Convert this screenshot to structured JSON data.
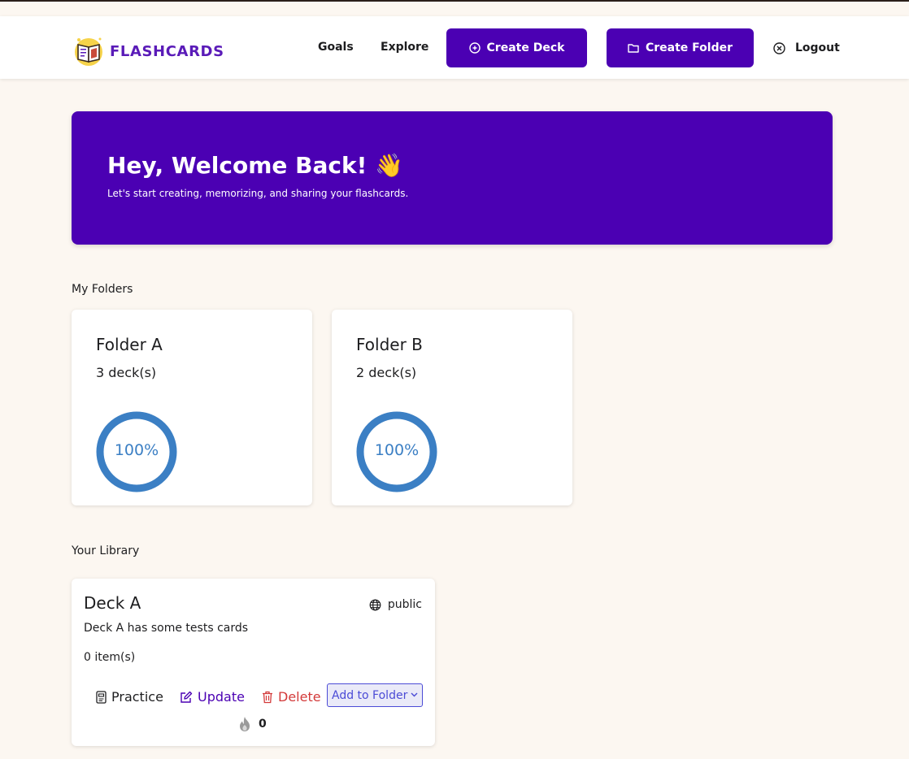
{
  "brand": {
    "name": "FLASHCARDS",
    "color": "#5a1bb8"
  },
  "nav": {
    "goals": "Goals",
    "explore": "Explore",
    "create_deck": "Create Deck",
    "create_folder": "Create Folder",
    "logout": "Logout",
    "button_color": "#4b00b3"
  },
  "hero": {
    "title": "Hey, Welcome Back! 👋",
    "subtitle": "Let's start creating, memorizing, and sharing your flashcards.",
    "color": "#4b00b3"
  },
  "folders": {
    "label": "My Folders",
    "items": [
      {
        "name": "Folder A",
        "count": "3 deck(s)",
        "progress": "100%",
        "progress_value": 1.0
      },
      {
        "name": "Folder B",
        "count": "2 deck(s)",
        "progress": "100%",
        "progress_value": 1.0
      }
    ],
    "progress_color": "#3b7fc4"
  },
  "library": {
    "label": "Your Library",
    "decks": [
      {
        "title": "Deck A",
        "visibility": "public",
        "description": "Deck A has some tests cards",
        "items": "0 item(s)",
        "practice": "Practice",
        "update": "Update",
        "delete": "Delete",
        "add_to_folder": "Add to Folder",
        "streak": "0"
      }
    ]
  },
  "icons": [
    "logo-book-icon",
    "plus-circle-icon",
    "folder-icon",
    "close-circle-icon",
    "globe-icon",
    "flashcard-icon",
    "edit-icon",
    "trash-icon",
    "chevron-down-icon",
    "flame-icon"
  ]
}
